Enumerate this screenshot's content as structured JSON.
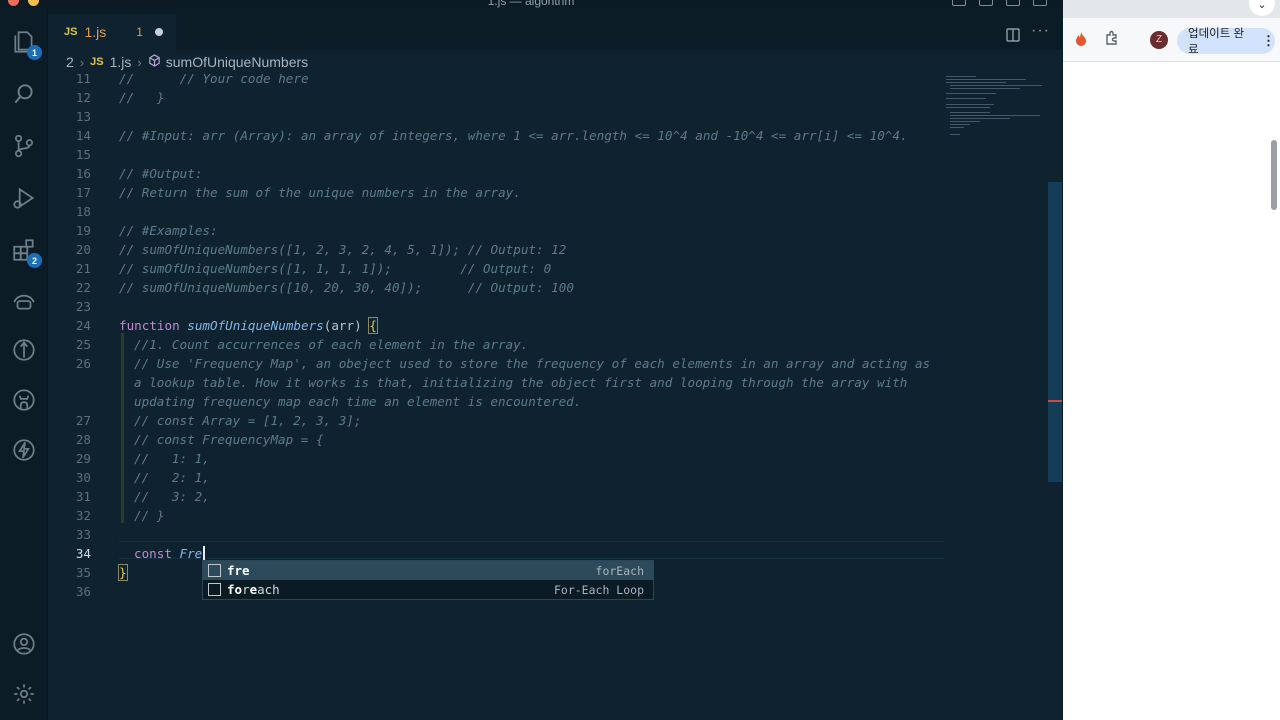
{
  "window": {
    "title": "1.js — algorithm"
  },
  "activity_bar": {
    "explorer_badge": "1",
    "extensions_badge": "2"
  },
  "tab": {
    "icon_label": "JS",
    "filename": "1.js",
    "problem_count": "1"
  },
  "breadcrumb": {
    "folder": "2",
    "file_icon_label": "JS",
    "file": "1.js",
    "symbol": "sumOfUniqueNumbers"
  },
  "editor": {
    "line_numbers": [
      "11",
      "12",
      "13",
      "14",
      "15",
      "16",
      "17",
      "18",
      "19",
      "20",
      "21",
      "22",
      "23",
      "24",
      "25",
      "26",
      "27",
      "28",
      "29",
      "30",
      "31",
      "32",
      "33",
      "34",
      "35",
      "36"
    ],
    "current_line": "34",
    "lines": {
      "l11": "//      // Your code here",
      "l12": "//   }",
      "l14": "// #Input: arr (Array): an array of integers, where 1 <= arr.length <= 10^4 and -10^4 <= arr[i] <= 10^4.",
      "l16": "// #Output:",
      "l17": "// Return the sum of the unique numbers in the array.",
      "l19": "// #Examples:",
      "l20": "// sumOfUniqueNumbers([1, 2, 3, 2, 4, 5, 1]); // Output: 12",
      "l21": "// sumOfUniqueNumbers([1, 1, 1, 1]);         // Output: 0",
      "l22": "// sumOfUniqueNumbers([10, 20, 30, 40]);      // Output: 100",
      "l24_keyword": "function",
      "l24_name": "sumOfUniqueNumbers",
      "l24_params": "(arr) ",
      "l24_brace": "{",
      "l25": "//1. Count accurrences of each element in the array.",
      "l26a": "// Use 'Frequency Map', an obeject used to store the frequency of each elements in an array and acting as",
      "l26b": "a lookup table. How it works is that, initializing the object first and looping through the array with",
      "l26c": "updating frequency map each time an element is encountered.",
      "l27": "// const Array = [1, 2, 3, 3];",
      "l28": "// const FrequencyMap = {",
      "l29": "//   1: 1,",
      "l30": "//   2: 1,",
      "l31": "//   3: 2,",
      "l32": "// }",
      "l34_keyword": "const",
      "l34_typed": "Fre",
      "l35_brace": "}"
    }
  },
  "suggestions": [
    {
      "label_match": "fre",
      "label_rest": "",
      "detail": "forEach",
      "selected": true
    },
    {
      "label_match": "fo",
      "label_mid": "r",
      "label_match2": "e",
      "label_rest": "ach",
      "detail": "For-Each Loop",
      "selected": false
    }
  ],
  "chrome": {
    "update_button": "업데이트 완료",
    "update_more": "⋮",
    "profile_initial": "Z",
    "dropdown": "⌄"
  },
  "colors": {
    "editor_bg": "#0f2230",
    "comment": "#5a7c8d",
    "keyword": "#c08acb",
    "function": "#82b8e8",
    "accent_badge": "#1b6fb8",
    "tab_modified": "#e0a050"
  }
}
